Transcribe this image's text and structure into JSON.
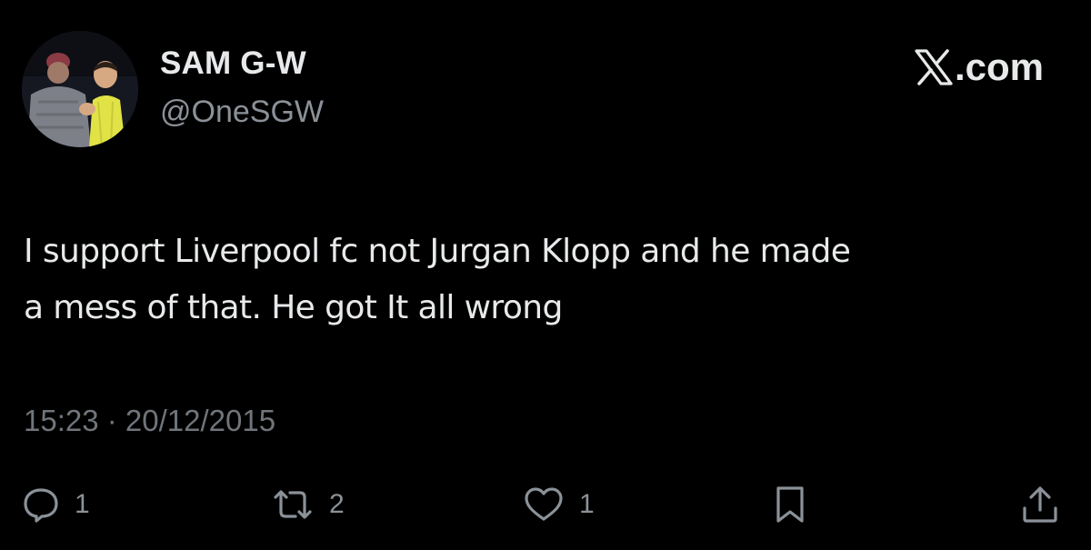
{
  "author": {
    "display_name": "SAM G-W",
    "handle": "@OneSGW",
    "avatar_icon": "profile-photo"
  },
  "brand": {
    "label": ".com",
    "icon": "x-logo-icon"
  },
  "tweet": {
    "text_line1": "I support Liverpool fc not Jurgan Klopp and he made",
    "text_line2": "a mess of that. He got It all wrong",
    "timestamp": "15:23 · 20/12/2015"
  },
  "actions": {
    "reply_count": "1",
    "retweet_count": "2",
    "like_count": "1"
  },
  "colors": {
    "background": "#000000",
    "primary_text": "#e7e9ea",
    "secondary_text": "#8b9198"
  }
}
